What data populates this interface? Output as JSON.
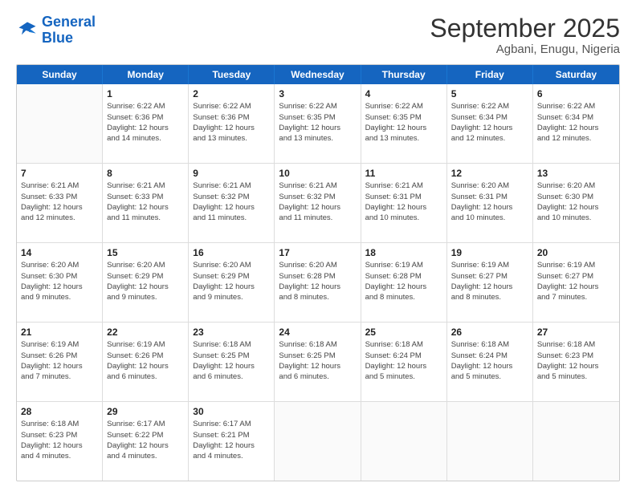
{
  "logo": {
    "line1": "General",
    "line2": "Blue"
  },
  "title": "September 2025",
  "location": "Agbani, Enugu, Nigeria",
  "weekdays": [
    "Sunday",
    "Monday",
    "Tuesday",
    "Wednesday",
    "Thursday",
    "Friday",
    "Saturday"
  ],
  "rows": [
    [
      {
        "day": "",
        "info": ""
      },
      {
        "day": "1",
        "info": "Sunrise: 6:22 AM\nSunset: 6:36 PM\nDaylight: 12 hours\nand 14 minutes."
      },
      {
        "day": "2",
        "info": "Sunrise: 6:22 AM\nSunset: 6:36 PM\nDaylight: 12 hours\nand 13 minutes."
      },
      {
        "day": "3",
        "info": "Sunrise: 6:22 AM\nSunset: 6:35 PM\nDaylight: 12 hours\nand 13 minutes."
      },
      {
        "day": "4",
        "info": "Sunrise: 6:22 AM\nSunset: 6:35 PM\nDaylight: 12 hours\nand 13 minutes."
      },
      {
        "day": "5",
        "info": "Sunrise: 6:22 AM\nSunset: 6:34 PM\nDaylight: 12 hours\nand 12 minutes."
      },
      {
        "day": "6",
        "info": "Sunrise: 6:22 AM\nSunset: 6:34 PM\nDaylight: 12 hours\nand 12 minutes."
      }
    ],
    [
      {
        "day": "7",
        "info": "Sunrise: 6:21 AM\nSunset: 6:33 PM\nDaylight: 12 hours\nand 12 minutes."
      },
      {
        "day": "8",
        "info": "Sunrise: 6:21 AM\nSunset: 6:33 PM\nDaylight: 12 hours\nand 11 minutes."
      },
      {
        "day": "9",
        "info": "Sunrise: 6:21 AM\nSunset: 6:32 PM\nDaylight: 12 hours\nand 11 minutes."
      },
      {
        "day": "10",
        "info": "Sunrise: 6:21 AM\nSunset: 6:32 PM\nDaylight: 12 hours\nand 11 minutes."
      },
      {
        "day": "11",
        "info": "Sunrise: 6:21 AM\nSunset: 6:31 PM\nDaylight: 12 hours\nand 10 minutes."
      },
      {
        "day": "12",
        "info": "Sunrise: 6:20 AM\nSunset: 6:31 PM\nDaylight: 12 hours\nand 10 minutes."
      },
      {
        "day": "13",
        "info": "Sunrise: 6:20 AM\nSunset: 6:30 PM\nDaylight: 12 hours\nand 10 minutes."
      }
    ],
    [
      {
        "day": "14",
        "info": "Sunrise: 6:20 AM\nSunset: 6:30 PM\nDaylight: 12 hours\nand 9 minutes."
      },
      {
        "day": "15",
        "info": "Sunrise: 6:20 AM\nSunset: 6:29 PM\nDaylight: 12 hours\nand 9 minutes."
      },
      {
        "day": "16",
        "info": "Sunrise: 6:20 AM\nSunset: 6:29 PM\nDaylight: 12 hours\nand 9 minutes."
      },
      {
        "day": "17",
        "info": "Sunrise: 6:20 AM\nSunset: 6:28 PM\nDaylight: 12 hours\nand 8 minutes."
      },
      {
        "day": "18",
        "info": "Sunrise: 6:19 AM\nSunset: 6:28 PM\nDaylight: 12 hours\nand 8 minutes."
      },
      {
        "day": "19",
        "info": "Sunrise: 6:19 AM\nSunset: 6:27 PM\nDaylight: 12 hours\nand 8 minutes."
      },
      {
        "day": "20",
        "info": "Sunrise: 6:19 AM\nSunset: 6:27 PM\nDaylight: 12 hours\nand 7 minutes."
      }
    ],
    [
      {
        "day": "21",
        "info": "Sunrise: 6:19 AM\nSunset: 6:26 PM\nDaylight: 12 hours\nand 7 minutes."
      },
      {
        "day": "22",
        "info": "Sunrise: 6:19 AM\nSunset: 6:26 PM\nDaylight: 12 hours\nand 6 minutes."
      },
      {
        "day": "23",
        "info": "Sunrise: 6:18 AM\nSunset: 6:25 PM\nDaylight: 12 hours\nand 6 minutes."
      },
      {
        "day": "24",
        "info": "Sunrise: 6:18 AM\nSunset: 6:25 PM\nDaylight: 12 hours\nand 6 minutes."
      },
      {
        "day": "25",
        "info": "Sunrise: 6:18 AM\nSunset: 6:24 PM\nDaylight: 12 hours\nand 5 minutes."
      },
      {
        "day": "26",
        "info": "Sunrise: 6:18 AM\nSunset: 6:24 PM\nDaylight: 12 hours\nand 5 minutes."
      },
      {
        "day": "27",
        "info": "Sunrise: 6:18 AM\nSunset: 6:23 PM\nDaylight: 12 hours\nand 5 minutes."
      }
    ],
    [
      {
        "day": "28",
        "info": "Sunrise: 6:18 AM\nSunset: 6:23 PM\nDaylight: 12 hours\nand 4 minutes."
      },
      {
        "day": "29",
        "info": "Sunrise: 6:17 AM\nSunset: 6:22 PM\nDaylight: 12 hours\nand 4 minutes."
      },
      {
        "day": "30",
        "info": "Sunrise: 6:17 AM\nSunset: 6:21 PM\nDaylight: 12 hours\nand 4 minutes."
      },
      {
        "day": "",
        "info": ""
      },
      {
        "day": "",
        "info": ""
      },
      {
        "day": "",
        "info": ""
      },
      {
        "day": "",
        "info": ""
      }
    ]
  ]
}
